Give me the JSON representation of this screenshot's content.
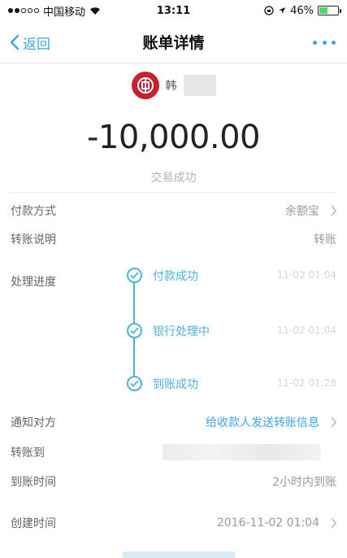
{
  "status_bar": {
    "carrier": "中国移动",
    "time": "13:11",
    "battery": "46%",
    "battery_level": 0.46
  },
  "nav": {
    "back_label": "返回",
    "title": "账单详情"
  },
  "payee": {
    "name_initial": "韩"
  },
  "amount": "-10,000.00",
  "status": "交易成功",
  "details": {
    "payment_method_label": "付款方式",
    "payment_method_value": "余额宝",
    "note_label": "转账说明",
    "note_value": "转账",
    "progress_label": "处理进度",
    "notify_label": "通知对方",
    "notify_value": "给收款人发送转账信息",
    "to_label": "转账到",
    "arrival_label": "到账时间",
    "arrival_value": "2小时内到账",
    "created_label": "创建时间",
    "created_value": "2016-11-02 01:04"
  },
  "progress": [
    {
      "label": "付款成功",
      "time": "11-02 01:04"
    },
    {
      "label": "银行处理中",
      "time": "11-02 01:04"
    },
    {
      "label": "到账成功",
      "time": "11-02 01:28"
    }
  ],
  "colors": {
    "accent": "#3aa7e0",
    "timeline": "#4cb3d8",
    "bank": "#c8202c"
  }
}
